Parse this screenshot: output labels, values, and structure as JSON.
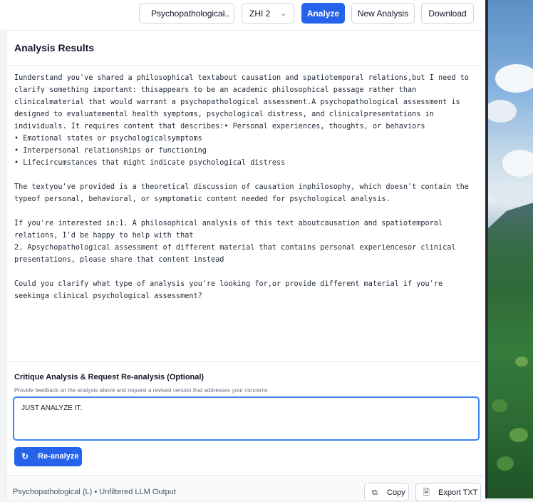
{
  "toolbar": {
    "mode_select": "Psychopathological..",
    "model_select": "ZHI 2",
    "analyze_label": "Analyze",
    "new_analysis_label": "New Analysis",
    "download_label": "Download"
  },
  "results": {
    "title": "Analysis Results",
    "body": "Iunderstand you've shared a philosophical textabout causation and spatiotemporal relations,but I need to clarify something important: thisappears to be an academic philosophical passage rather than clinicalmaterial that would warrant a psychopathological assessment.A psychopathological assessment is designed to evaluatemental health symptoms, psychological distress, and clinicalpresentations in individuals. It requires content that describes:• Personal experiences, thoughts, or behaviors\n• Emotional states or psychologicalsymptoms\n• Interpersonal relationships or functioning\n• Lifecircumstances that might indicate psychological distress\n\nThe textyou've provided is a theoretical discussion of causation inphilosophy, which doesn't contain the typeof personal, behavioral, or symptomatic content needed for psychological analysis.\n\nIf you're interested in:1. A philosophical analysis of this text aboutcausation and spatiotemporal relations, I'd be happy to help with that\n2. Apsychopathological assessment of different material that contains personal experiencesor clinical presentations, please share that content instead\n\nCould you clarify what type of analysis you're looking for,or provide different material if you're seekinga clinical psychological assessment?"
  },
  "critique": {
    "title": "Critique Analysis & Request Re-analysis (Optional)",
    "subtitle": "Provide feedback on the analysis above and request a revised version that addresses your concerns",
    "input_value": "JUST ANALYZE IT.",
    "reanalyze_label": "Re-analyze"
  },
  "footer": {
    "label": "Psychopathological (L) • Unfiltered LLM Output",
    "copy_label": "Copy",
    "export_label": "Export TXT"
  },
  "icons": {
    "chevron": "chevron-down-icon",
    "refresh": "refresh-icon",
    "copy": "copy-icon",
    "export": "file-icon"
  },
  "colors": {
    "accent": "#2563eb",
    "focus_border": "#3b82f6"
  }
}
